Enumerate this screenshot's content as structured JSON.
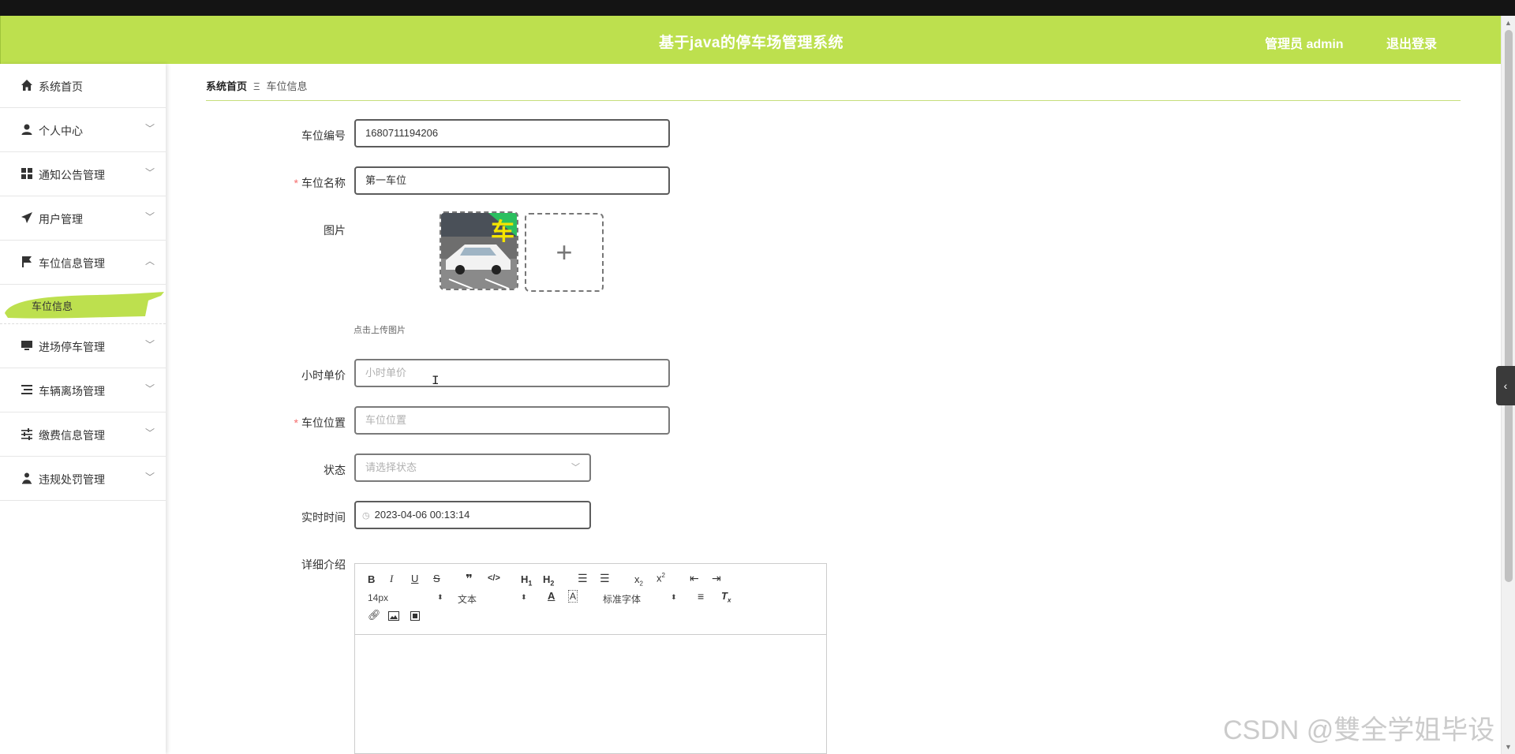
{
  "header": {
    "title": "基于java的停车场管理系统",
    "user": "管理员 admin",
    "logout": "退出登录",
    "color": "#bde04e"
  },
  "sidebar": {
    "items": [
      {
        "label": "系统首页",
        "icon": "home-icon",
        "expandable": false
      },
      {
        "label": "个人中心",
        "icon": "user-icon",
        "expandable": true
      },
      {
        "label": "通知公告管理",
        "icon": "grid-icon",
        "expandable": true
      },
      {
        "label": "用户管理",
        "icon": "send-icon",
        "expandable": true
      },
      {
        "label": "车位信息管理",
        "icon": "flag-icon",
        "expandable": true,
        "expanded": true
      },
      {
        "label": "进场停车管理",
        "icon": "monitor-icon",
        "expandable": true
      },
      {
        "label": "车辆离场管理",
        "icon": "list-icon",
        "expandable": true
      },
      {
        "label": "缴费信息管理",
        "icon": "sliders-icon",
        "expandable": true
      },
      {
        "label": "违规处罚管理",
        "icon": "person-icon",
        "expandable": true
      }
    ],
    "active_sub": "车位信息"
  },
  "breadcrumb": {
    "home": "系统首页",
    "current": "车位信息"
  },
  "form": {
    "code": {
      "label": "车位编号",
      "value": "1680711194206"
    },
    "name": {
      "label": "车位名称",
      "value": "第一车位",
      "required": true
    },
    "image": {
      "label": "图片",
      "hint": "点击上传图片",
      "thumb_text": "车"
    },
    "price": {
      "label": "小时单价",
      "placeholder": "小时单价"
    },
    "location": {
      "label": "车位位置",
      "placeholder": "车位位置",
      "required": true
    },
    "status": {
      "label": "状态",
      "placeholder": "请选择状态"
    },
    "time": {
      "label": "实时时间",
      "value": "2023-04-06 00:13:14"
    },
    "detail": {
      "label": "详细介绍"
    }
  },
  "editor": {
    "font_size": "14px",
    "header_select": "文本",
    "font_select": "标准字体"
  },
  "watermark": "CSDN @雙全学姐毕设"
}
